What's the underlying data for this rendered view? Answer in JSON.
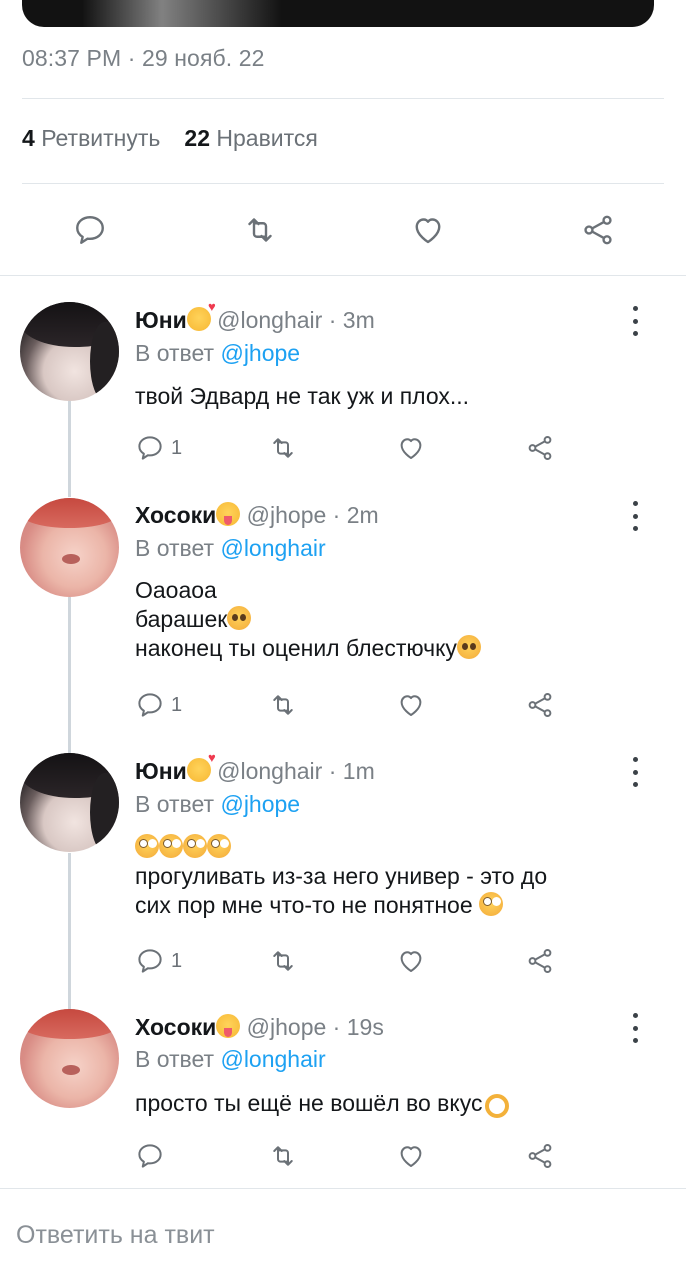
{
  "tweet": {
    "timestamp": "08:37 PM · 29 нояб. 22",
    "retweets_count": "4",
    "retweets_label": "Ретвитнуть",
    "likes_count": "22",
    "likes_label": "Нравится"
  },
  "actions": {
    "reply_icon": "comment-icon",
    "retweet_icon": "retweet-icon",
    "like_icon": "heart-icon",
    "share_icon": "share-icon"
  },
  "replies": [
    {
      "name": "Юни",
      "name_emoji": "smiling-face-with-hearts",
      "handle": "@longhair",
      "time": "3m",
      "reply_prefix": "В ответ",
      "reply_to": "@jhope",
      "lines": [
        "твой Эдвард не так уж и плох..."
      ],
      "reply_count": "1"
    },
    {
      "name": "Хосоки",
      "name_emoji": "winking-face-with-tongue",
      "handle": "@jhope",
      "time": "2m",
      "reply_prefix": "В ответ",
      "reply_to": "@longhair",
      "lines": [
        "Оаоаоа",
        "барашек",
        "наконец ты оценил блестючку"
      ],
      "reply_count": "1"
    },
    {
      "name": "Юни",
      "name_emoji": "smiling-face-with-hearts",
      "handle": "@longhair",
      "time": "1m",
      "reply_prefix": "В ответ",
      "reply_to": "@jhope",
      "lines": [
        "",
        "прогуливать из-за него универ - это до",
        "сих пор мне что-то не понятное"
      ],
      "reply_count": "1"
    },
    {
      "name": "Хосоки",
      "name_emoji": "winking-face-with-tongue",
      "handle": "@jhope",
      "time": "19s",
      "reply_prefix": "В ответ",
      "reply_to": "@longhair",
      "lines": [
        "просто ты ещё не вошёл во вкус"
      ],
      "reply_count": ""
    }
  ],
  "composer": {
    "placeholder": "Ответить на твит"
  },
  "colors": {
    "accent": "#1da1f2",
    "text": "#14171a",
    "muted": "#7a8086",
    "divider": "#e1e6ea"
  }
}
